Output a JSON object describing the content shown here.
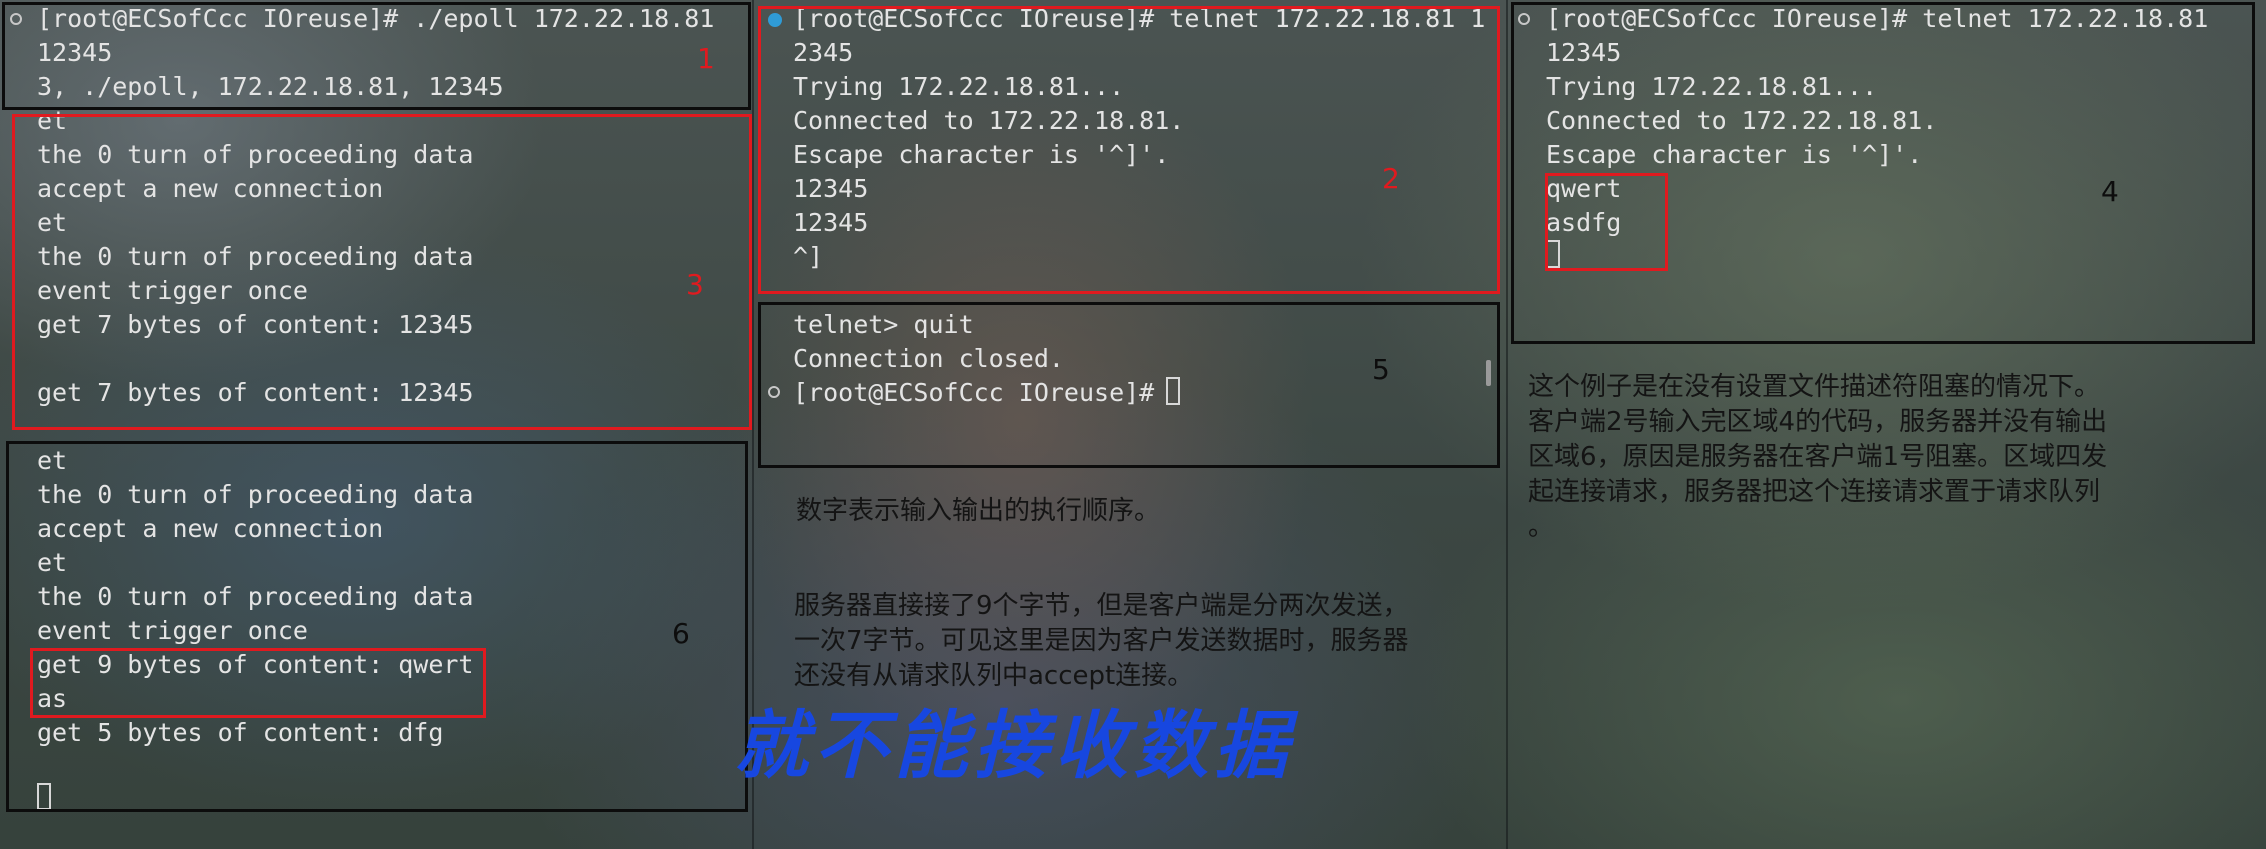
{
  "pane1": {
    "header_lines": [
      "[root@ECSofCcc IOreuse]# ./epoll 172.22.18.81",
      "12345",
      "3, ./epoll, 172.22.18.81, 12345"
    ],
    "region3_lines": [
      "et",
      "the 0 turn of proceeding data",
      "accept a new connection",
      "et",
      "the 0 turn of proceeding data",
      "event trigger once",
      "get 7 bytes of content: 12345",
      "",
      "get 7 bytes of content: 12345"
    ],
    "region6_lines": [
      "et",
      "the 0 turn of proceeding data",
      "accept a new connection",
      "et",
      "the 0 turn of proceeding data",
      "event trigger once",
      "get 9 bytes of content: qwert",
      "as",
      "get 5 bytes of content: dfg"
    ]
  },
  "pane2": {
    "region2_lines": [
      "[root@ECSofCcc IOreuse]# telnet 172.22.18.81 1",
      "2345",
      "Trying 172.22.18.81...",
      "Connected to 172.22.18.81.",
      "Escape character is '^]'.",
      "12345",
      "12345",
      "^]"
    ],
    "region5_lines": [
      "telnet> quit",
      "Connection closed.",
      "[root@ECSofCcc IOreuse]# "
    ]
  },
  "pane3": {
    "region4_lines": [
      "[root@ECSofCcc IOreuse]# telnet 172.22.18.81",
      "12345",
      "Trying 172.22.18.81...",
      "Connected to 172.22.18.81.",
      "Escape character is '^]'.",
      "qwert",
      "asdfg"
    ]
  },
  "labels": {
    "n1": "1",
    "n2": "2",
    "n3": "3",
    "n4": "4",
    "n5": "5",
    "n6": "6"
  },
  "notes": {
    "order": "数字表示输入输出的执行顺序。",
    "bytes": "服务器直接接了9个字节，但是客户端是分两次发送，\n一次7字节。可见这里是因为客户发送数据时，服务器\n还没有从请求队列中accept连接。",
    "explain": "这个例子是在没有设置文件描述符阻塞的情况下。\n客户端2号输入完区域4的代码，服务器并没有输出\n区域6，原因是服务器在客户端1号阻塞。区域四发\n起连接请求，服务器把这个连接请求置于请求队列\n。",
    "handwritten": "就不能接收数据"
  },
  "colors": {
    "annotation_red": "#e01a1f",
    "terminal_text": "#e4e4e4",
    "handwriting_blue": "#1747e0",
    "active_marker": "#2f9bd6"
  }
}
